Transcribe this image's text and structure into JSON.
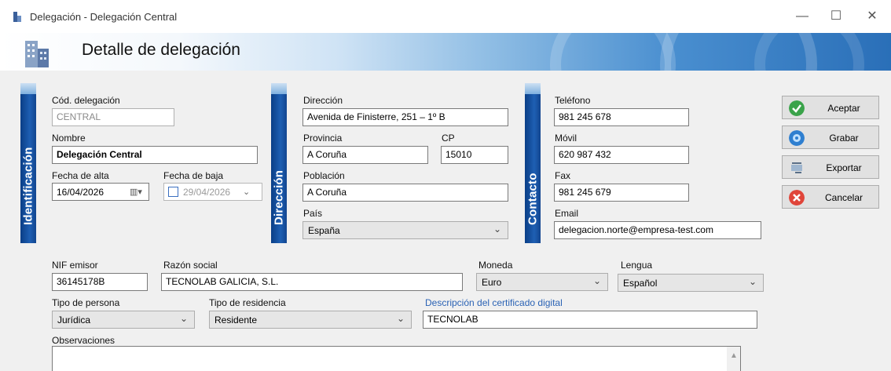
{
  "window": {
    "title": "Delegación - Delegación Central"
  },
  "header": {
    "title": "Detalle de delegación"
  },
  "sections": {
    "identificacion": "Identificación",
    "direccion": "Dirección",
    "contacto": "Contacto"
  },
  "identificacion": {
    "cod_label": "Cód. delegación",
    "cod_value": "CENTRAL",
    "nombre_label": "Nombre",
    "nombre_value": "Delegación Central",
    "alta_label": "Fecha de alta",
    "alta_value": "16/04/2026",
    "baja_label": "Fecha de baja",
    "baja_value": "29/04/2026"
  },
  "direccion": {
    "dir_label": "Dirección",
    "dir_value": "Avenida de Finisterre, 251 – 1º B",
    "provincia_label": "Provincia",
    "provincia_value": "A Coruña",
    "cp_label": "CP",
    "cp_value": "15010",
    "poblacion_label": "Población",
    "poblacion_value": "A Coruña",
    "pais_label": "País",
    "pais_value": "España"
  },
  "contacto": {
    "tel_label": "Teléfono",
    "tel_value": "981 245 678",
    "movil_label": "Móvil",
    "movil_value": "620 987 432",
    "fax_label": "Fax",
    "fax_value": "981 245 679",
    "email_label": "Email",
    "email_value": "delegacion.norte@empresa-test.com"
  },
  "fiscal": {
    "nif_label": "NIF emisor",
    "nif_value": "36145178B",
    "razon_label": "Razón social",
    "razon_value": "TECNOLAB GALICIA, S.L.",
    "moneda_label": "Moneda",
    "moneda_value": "Euro",
    "lengua_label": "Lengua",
    "lengua_value": "Español",
    "persona_label": "Tipo de persona",
    "persona_value": "Jurídica",
    "residencia_label": "Tipo de residencia",
    "residencia_value": "Residente",
    "cert_label": "Descripción del certificado digital",
    "cert_value": "TECNOLAB",
    "obs_label": "Observaciones"
  },
  "buttons": {
    "aceptar": "Aceptar",
    "grabar": "Grabar",
    "exportar": "Exportar",
    "cancelar": "Cancelar"
  },
  "colors": {
    "section_tab": "#1e5fb3",
    "aceptar": "#3aa34a",
    "cancelar": "#e0453a",
    "accent_label": "#2b63b5"
  },
  "icons": {
    "app": "building-icon",
    "aceptar": "check-icon",
    "grabar": "disk-icon",
    "exportar": "export-icon",
    "cancelar": "close-circle-icon",
    "calendar": "calendar-icon"
  }
}
